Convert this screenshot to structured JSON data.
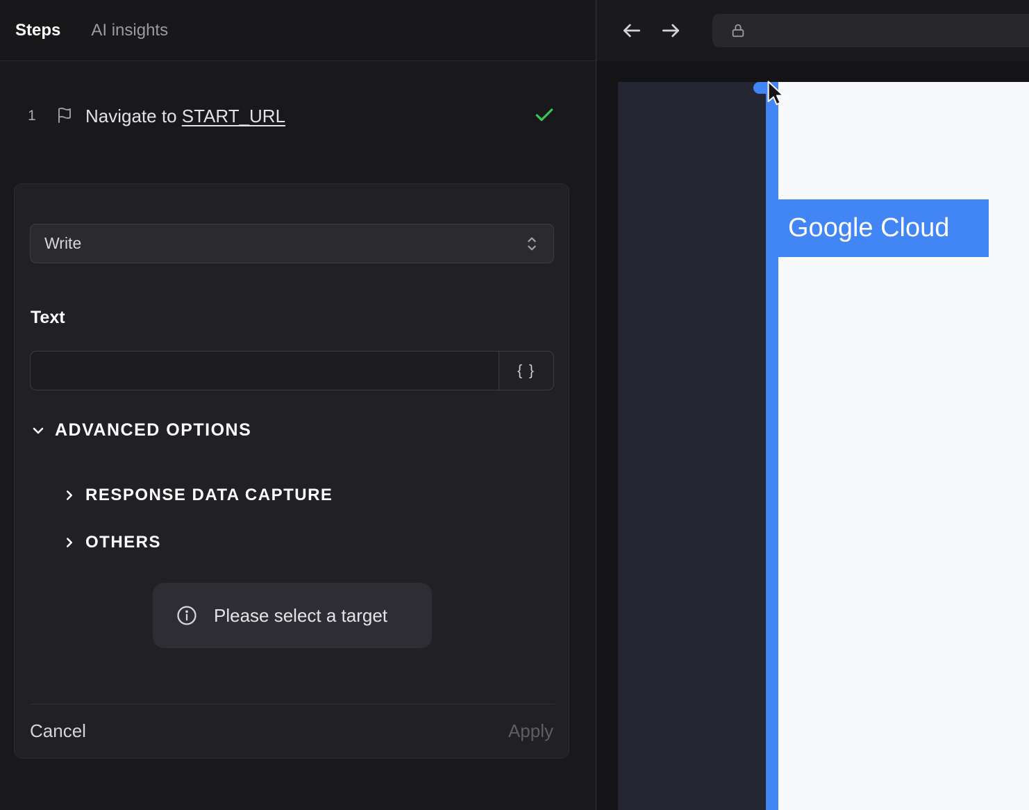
{
  "left_panel": {
    "tabs": [
      {
        "label": "Steps",
        "active": true
      },
      {
        "label": "AI insights",
        "active": false
      }
    ],
    "step": {
      "number": "1",
      "text_prefix": "Navigate to ",
      "text_link": "START_URL",
      "status": "success"
    },
    "editor": {
      "action_select": {
        "value": "Write"
      },
      "text_field": {
        "label": "Text",
        "value": "",
        "placeholder": ""
      },
      "variable_button_label": "{ }",
      "advanced_options_label": "ADVANCED OPTIONS",
      "sections": [
        {
          "label": "RESPONSE DATA CAPTURE"
        },
        {
          "label": "OTHERS"
        }
      ],
      "toast": {
        "text": "Please select a target"
      },
      "footer": {
        "cancel_label": "Cancel",
        "apply_label": "Apply"
      }
    }
  },
  "browser": {
    "url_bar": {
      "value": ""
    },
    "page": {
      "highlight_label": "Google Cloud"
    }
  },
  "colors": {
    "accent_blue": "#4285f4",
    "success_green": "#36c857",
    "panel_dark": "#19191c",
    "page_light": "#f8f9fa"
  },
  "icons": {
    "step": "flag-icon",
    "step_status": "check-icon",
    "select": "chevrons-up-down-icon",
    "advanced": "chevron-down-icon",
    "section": "chevron-right-icon",
    "toast": "info-icon",
    "nav": [
      "arrow-left-icon",
      "arrow-right-icon"
    ],
    "url": "lock-icon",
    "pointer": "cursor-arrow-icon"
  }
}
